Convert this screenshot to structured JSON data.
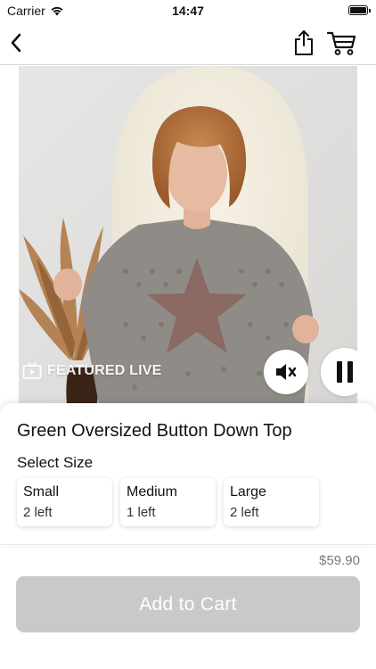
{
  "status_bar": {
    "carrier": "Carrier",
    "time": "14:47"
  },
  "nav": {
    "back_icon": "chevron-left-icon",
    "share_icon": "share-icon",
    "cart_icon": "cart-icon"
  },
  "video": {
    "badge_label": "FEATURED LIVE",
    "badge_icon": "tv-icon",
    "mute_icon": "speaker-muted-icon",
    "pause_icon": "pause-icon"
  },
  "product": {
    "title": "Green Oversized Button Down Top",
    "select_size_label": "Select Size",
    "sizes": [
      {
        "name": "Small",
        "availability": "2 left"
      },
      {
        "name": "Medium",
        "availability": "1 left"
      },
      {
        "name": "Large",
        "availability": "2 left"
      }
    ],
    "price": "$59.90",
    "add_to_cart_label": "Add to Cart"
  },
  "colors": {
    "button_disabled": "#c9c9c9",
    "price_text": "#7a7a7a"
  }
}
